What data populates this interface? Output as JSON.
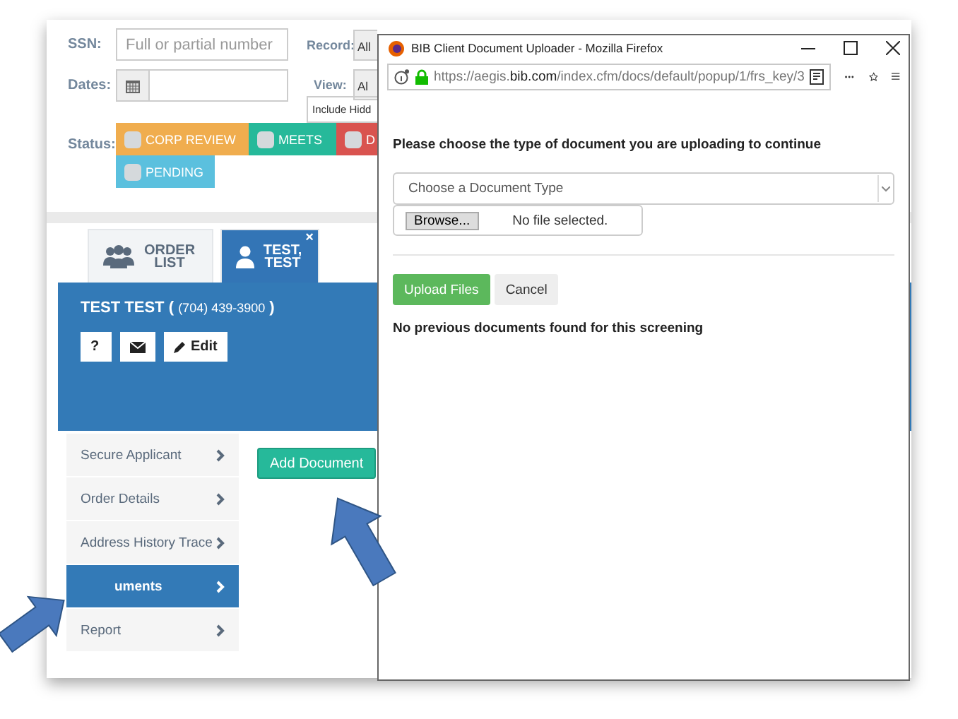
{
  "filters": {
    "ssn": {
      "label": "SSN:",
      "placeholder": "Full or partial number"
    },
    "record": {
      "label": "Record:",
      "value": "All"
    },
    "dates": {
      "label": "Dates:"
    },
    "view": {
      "label": "View:",
      "value": "Al"
    },
    "include_hidden": "Include Hidd",
    "status": {
      "label": "Status:",
      "options": [
        {
          "label": "CORP REVIEW",
          "color": "#f0ad4e",
          "checked": false
        },
        {
          "label": "MEETS",
          "color": "#26b99a",
          "checked": false
        },
        {
          "label": "D",
          "color": "#d9534f",
          "checked": false
        },
        {
          "label": "PENDING",
          "color": "#5bc0de",
          "checked": false
        }
      ]
    }
  },
  "tabs": [
    {
      "label": "ORDER LIST",
      "kind": "list",
      "selected": false
    },
    {
      "label": "TEST, TEST",
      "kind": "person",
      "selected": true,
      "close": "×"
    }
  ],
  "applicant": {
    "name": "TEST TEST (",
    "phone": "(704) 439-3900",
    "end": ")"
  },
  "action_buttons": [
    {
      "kind": "help",
      "label": "?"
    },
    {
      "kind": "mail"
    },
    {
      "kind": "edit",
      "label": "Edit"
    }
  ],
  "sidebar": {
    "items": [
      {
        "label": "Secure Applicant",
        "selected": false
      },
      {
        "label": "Order Details",
        "selected": false
      },
      {
        "label": "Address History Trace",
        "selected": false
      },
      {
        "label": "uments",
        "selected": true
      },
      {
        "label": "Report",
        "selected": false
      }
    ]
  },
  "add_button": "Add Document",
  "popup": {
    "title": "BIB Client Document Uploader - Mozilla Firefox",
    "url": {
      "prefix": "https://aegis.",
      "domain": "bib.com",
      "path": "/index.cfm/docs/default/popup/1/frs_key/3"
    },
    "prompt": "Please choose the type of document you are uploading to continue",
    "type_select": {
      "placeholder": "Choose a Document Type"
    },
    "browse_button": "Browse...",
    "file_status": "No file selected.",
    "buttons": [
      {
        "label": "Upload Files",
        "kind": "primary"
      },
      {
        "label": "Cancel",
        "kind": "default"
      }
    ],
    "message": "No previous documents found for this screening"
  }
}
